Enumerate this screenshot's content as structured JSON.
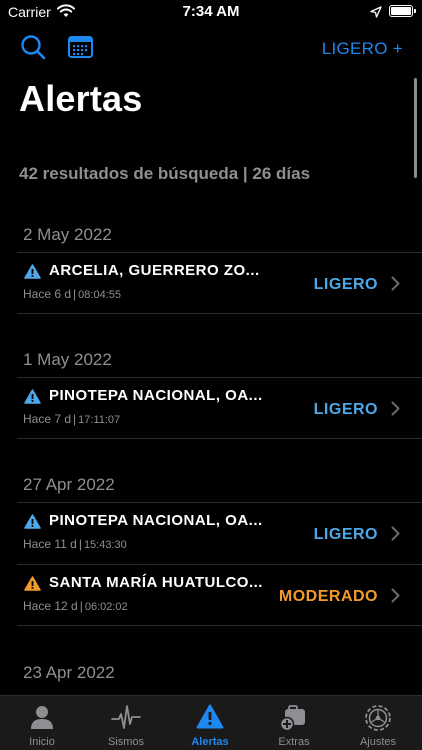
{
  "status": {
    "carrier": "Carrier",
    "time": "7:34 AM"
  },
  "nav": {
    "link": "LIGERO +"
  },
  "title": "Alertas",
  "summary": "42 resultados de búsqueda | 26 días",
  "colors": {
    "ligero": "#4ea8e8",
    "moderado": "#f29b2d",
    "accent": "#1e88f0"
  },
  "sections": [
    {
      "date": "2 May 2022",
      "rows": [
        {
          "title": "ARCELIA, GUERRERO ZO...",
          "ago": "Hace 6 d",
          "time": "08:04:55",
          "level": "LIGERO",
          "color": "#4ea8e8"
        }
      ]
    },
    {
      "date": "1 May 2022",
      "rows": [
        {
          "title": "PINOTEPA NACIONAL, OA...",
          "ago": "Hace 7 d",
          "time": "17:11:07",
          "level": "LIGERO",
          "color": "#4ea8e8"
        }
      ]
    },
    {
      "date": "27 Apr 2022",
      "rows": [
        {
          "title": "PINOTEPA NACIONAL, OA...",
          "ago": "Hace 11 d",
          "time": "15:43:30",
          "level": "LIGERO",
          "color": "#4ea8e8"
        },
        {
          "title": "SANTA MARÍA HUATULCO...",
          "ago": "Hace 12 d",
          "time": "06:02:02",
          "level": "MODERADO",
          "color": "#f29b2d"
        }
      ]
    },
    {
      "date": "23 Apr 2022",
      "rows": []
    }
  ],
  "tabs": [
    {
      "label": "Inicio",
      "icon": "person-icon"
    },
    {
      "label": "Sismos",
      "icon": "seismograph-icon"
    },
    {
      "label": "Alertas",
      "icon": "alert-icon"
    },
    {
      "label": "Extras",
      "icon": "extras-icon"
    },
    {
      "label": "Ajustes",
      "icon": "gear-icon"
    }
  ]
}
